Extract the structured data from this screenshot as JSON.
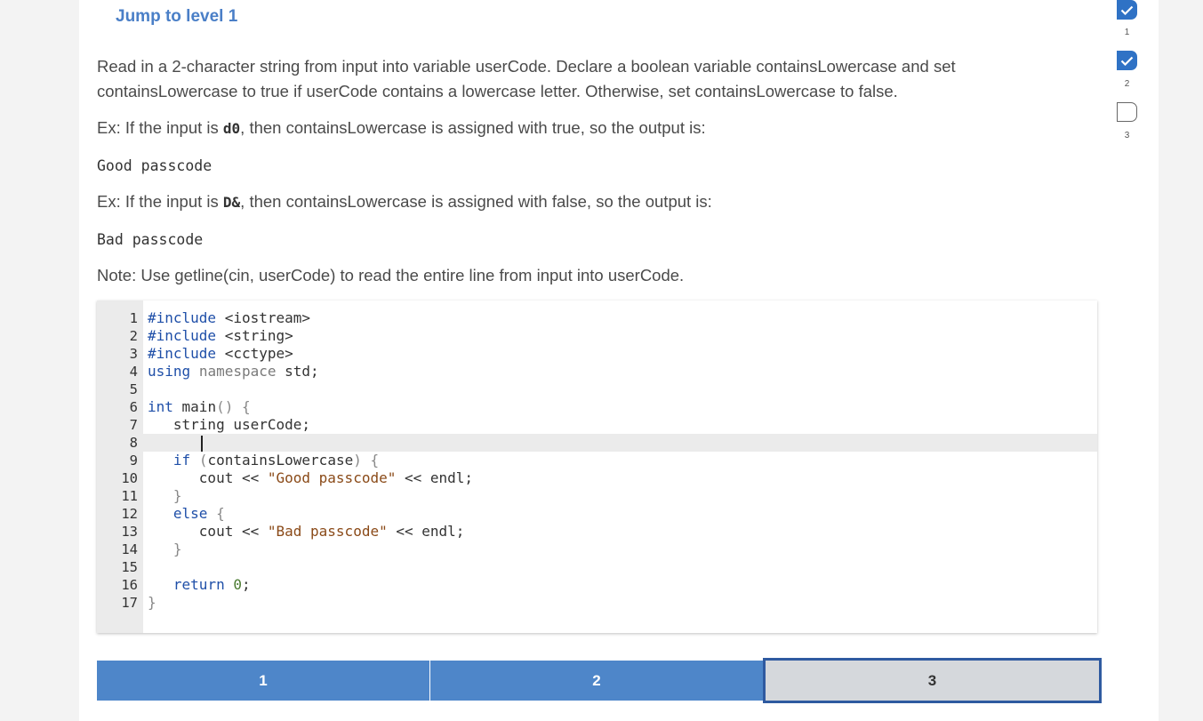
{
  "jump_link": "Jump to level 1",
  "prompt": {
    "p1": "Read in a 2-character string from input into variable userCode. Declare a boolean variable containsLowercase and set containsLowercase to true if userCode contains a lowercase letter. Otherwise, set containsLowercase to false.",
    "ex1_pre": "Ex: If the input is ",
    "ex1_code": "d0",
    "ex1_post": ", then containsLowercase is assigned with true, so the output is:",
    "ex1_output": "Good passcode",
    "ex2_pre": "Ex: If the input is ",
    "ex2_code": "D&",
    "ex2_post": ", then containsLowercase is assigned with false, so the output is:",
    "ex2_output": "Bad passcode",
    "note": "Note: Use getline(cin, userCode) to read the entire line from input into userCode."
  },
  "editor": {
    "active_line": 8,
    "lines": [
      {
        "n": "1",
        "text": "#include <iostream>"
      },
      {
        "n": "2",
        "text": "#include <string>"
      },
      {
        "n": "3",
        "text": "#include <cctype>"
      },
      {
        "n": "4",
        "text": "using namespace std;"
      },
      {
        "n": "5",
        "text": ""
      },
      {
        "n": "6",
        "text": "int main() {"
      },
      {
        "n": "7",
        "text": "   string userCode;"
      },
      {
        "n": "8",
        "text": ""
      },
      {
        "n": "9",
        "text": "   if (containsLowercase) {"
      },
      {
        "n": "10",
        "text": "      cout << \"Good passcode\" << endl;"
      },
      {
        "n": "11",
        "text": "   }"
      },
      {
        "n": "12",
        "text": "   else {"
      },
      {
        "n": "13",
        "text": "      cout << \"Bad passcode\" << endl;"
      },
      {
        "n": "14",
        "text": "   }"
      },
      {
        "n": "15",
        "text": ""
      },
      {
        "n": "16",
        "text": "   return 0;"
      },
      {
        "n": "17",
        "text": "}"
      }
    ]
  },
  "levels": {
    "tabs": [
      "1",
      "2",
      "3"
    ],
    "current": "3"
  },
  "progress": {
    "items": [
      {
        "label": "1",
        "status": "done",
        "icon": "check-icon"
      },
      {
        "label": "2",
        "status": "done",
        "icon": "check-icon"
      },
      {
        "label": "3",
        "status": "todo",
        "icon": "empty-box-icon"
      }
    ],
    "done_color": "#2f72c5"
  }
}
